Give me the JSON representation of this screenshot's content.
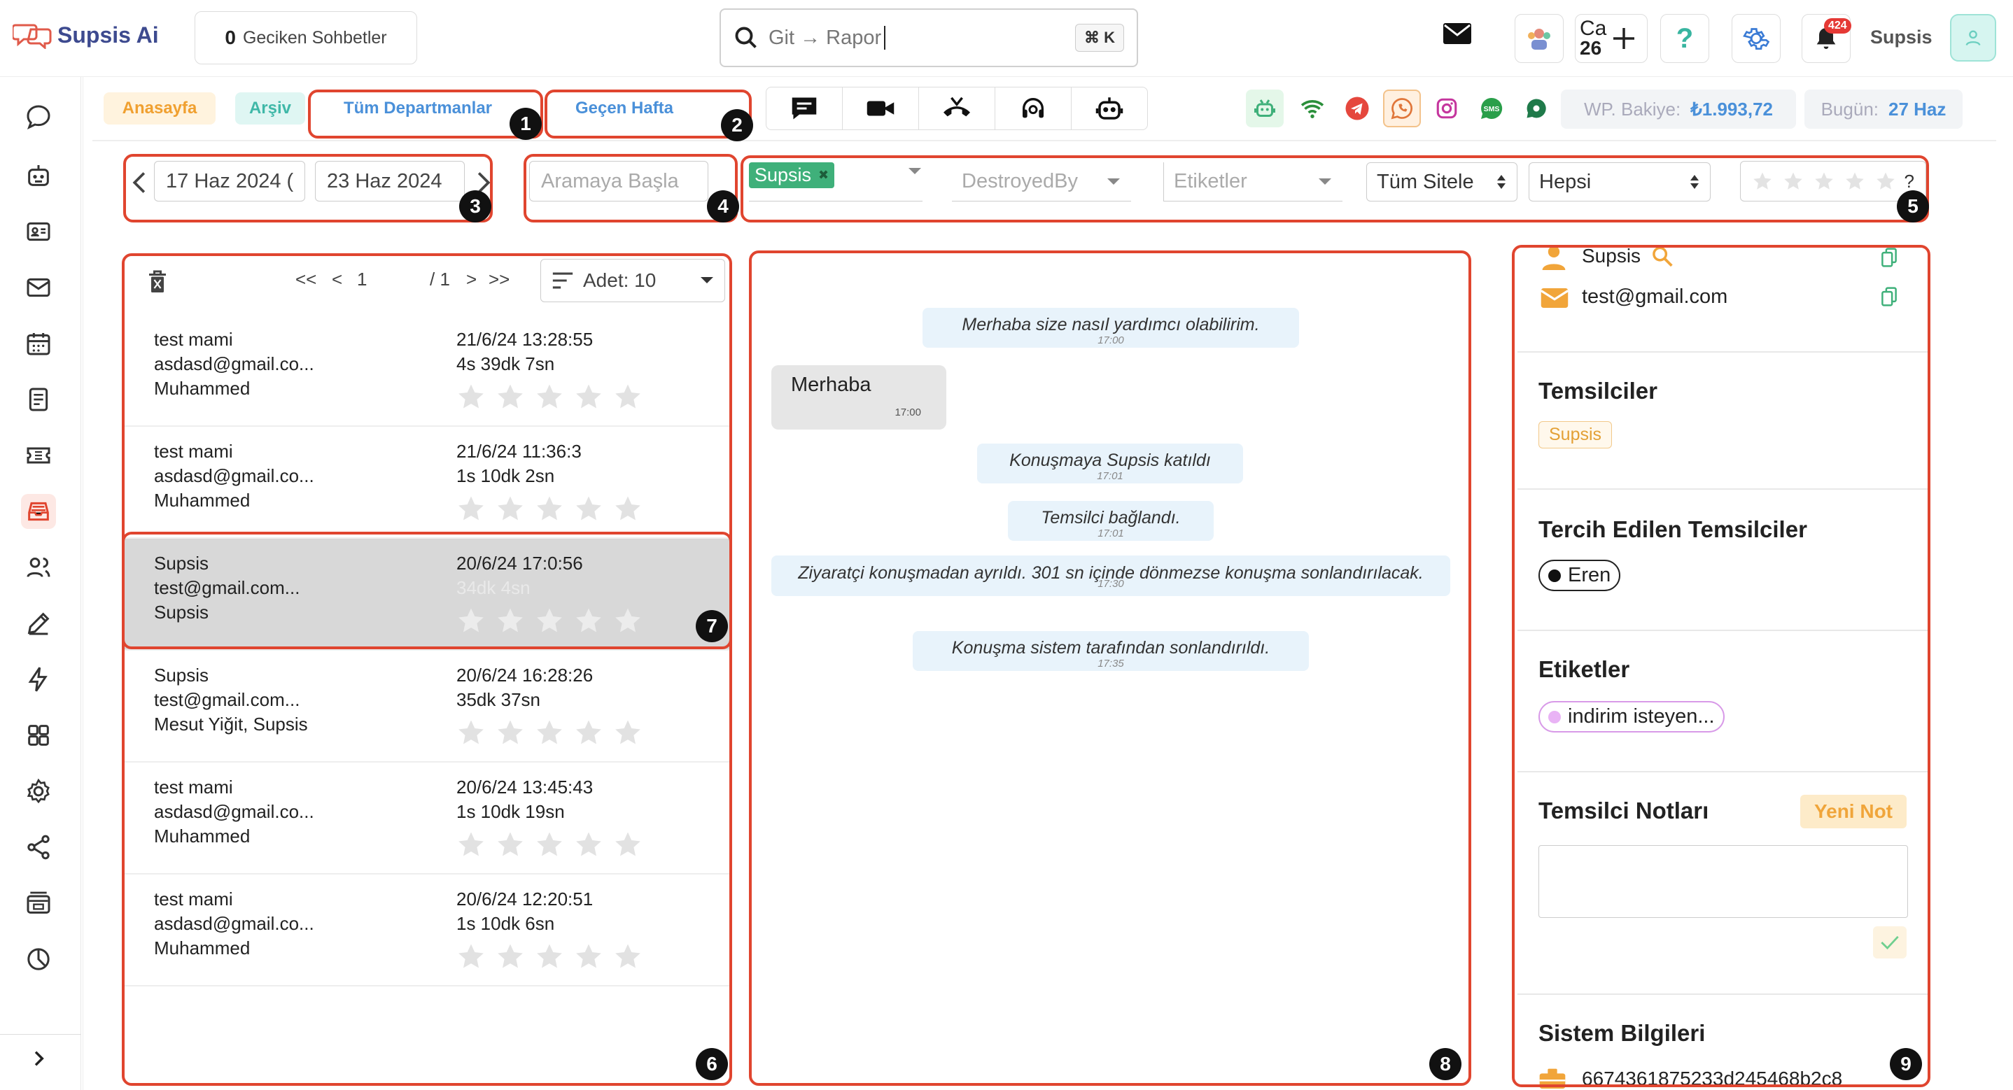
{
  "app": {
    "name": "Supsis Ai"
  },
  "topbar": {
    "delayed_count": "0",
    "delayed_label": "Geciken Sohbetler",
    "search_placeholder": "Git → Rapor",
    "shortcut": "⌘ K",
    "lang_code": "Ca",
    "day_num": "26",
    "notification_count": "424",
    "brand_label": "Supsis"
  },
  "tabs": {
    "home": "Anasayfa",
    "archive": "Arşiv",
    "departments": "Tüm Departmanlar",
    "period": "Geçen Hafta"
  },
  "channels": [
    "chat-icon",
    "video-icon",
    "call-end-icon",
    "headset-icon",
    "bot-icon"
  ],
  "sources": [
    "android-icon",
    "wifi-icon",
    "telegram-icon",
    "whatsapp-icon",
    "instagram-icon",
    "sms-icon",
    "webchat-icon"
  ],
  "balance": {
    "label": "WP. Bakiye:",
    "value": "₺1.993,72"
  },
  "today": {
    "label": "Bugün:",
    "value": "27 Haz"
  },
  "filters": {
    "date_start": "17 Haz 2024 (",
    "date_end": "23 Haz 2024",
    "search_placeholder": "Aramaya Başla",
    "agent_tag": "Supsis",
    "destroyed_placeholder": "DestroyedBy",
    "tags_placeholder": "Etiketler",
    "site_select": "Tüm Sitele",
    "status_select": "Hepsi",
    "rating_help": "?"
  },
  "pager": {
    "page": "1",
    "total": "/ 1",
    "per_page": "Adet: 10"
  },
  "conversations": [
    {
      "name": "test mami",
      "email": "asdasd@gmail.co...",
      "agent": "Muhammed",
      "date": "21/6/24 13:28:55",
      "duration": "4s 39dk 7sn"
    },
    {
      "name": "test mami",
      "email": "asdasd@gmail.co...",
      "agent": "Muhammed",
      "date": "21/6/24 11:36:3",
      "duration": "1s 10dk 2sn"
    },
    {
      "name": "Supsis",
      "email": "test@gmail.com...",
      "agent": "Supsis",
      "date": "20/6/24 17:0:56",
      "duration": "34dk 4sn"
    },
    {
      "name": "Supsis",
      "email": "test@gmail.com...",
      "agent": "Mesut Yiğit, Supsis",
      "date": "20/6/24 16:28:26",
      "duration": "35dk 37sn"
    },
    {
      "name": "test mami",
      "email": "asdasd@gmail.co...",
      "agent": "Muhammed",
      "date": "20/6/24 13:45:43",
      "duration": "1s 10dk 19sn"
    },
    {
      "name": "test mami",
      "email": "asdasd@gmail.co...",
      "agent": "Muhammed",
      "date": "20/6/24 12:20:51",
      "duration": "1s 10dk 6sn"
    }
  ],
  "chat": [
    {
      "text": "Merhaba size nasıl yardımcı olabilirim.",
      "time": "17:00"
    },
    {
      "text": "Merhaba",
      "time": "17:00"
    },
    {
      "text": "Konuşmaya Supsis katıldı",
      "time": "17:01"
    },
    {
      "text": "Temsilci bağlandı.",
      "time": "17:01"
    },
    {
      "text": "Ziyaratçi konuşmadan ayrıldı. 301 sn içinde dönmezse konuşma sonlandırılacak.",
      "time": "17:30"
    },
    {
      "text": "Konuşma sistem tarafından sonlandırıldı.",
      "time": "17:35"
    }
  ],
  "visitor": {
    "name": "Supsis",
    "email": "test@gmail.com"
  },
  "sections": {
    "reps_title": "Temsilciler",
    "rep": "Supsis",
    "pref_title": "Tercih Edilen Temsilciler",
    "pref": "Eren",
    "tags_title": "Etiketler",
    "tag": "indirim isteyen...",
    "notes_title": "Temsilci Notları",
    "new_note": "Yeni Not",
    "sys_title": "Sistem Bilgileri",
    "sys_id": "6674361875233d245468b2c8"
  },
  "markers": [
    "1",
    "2",
    "3",
    "4",
    "5",
    "6",
    "7",
    "8",
    "9"
  ],
  "colors": {
    "accent": "#e0452f",
    "brand": "#3d4a8f",
    "link": "#4a90d9",
    "green": "#3fb07a"
  }
}
